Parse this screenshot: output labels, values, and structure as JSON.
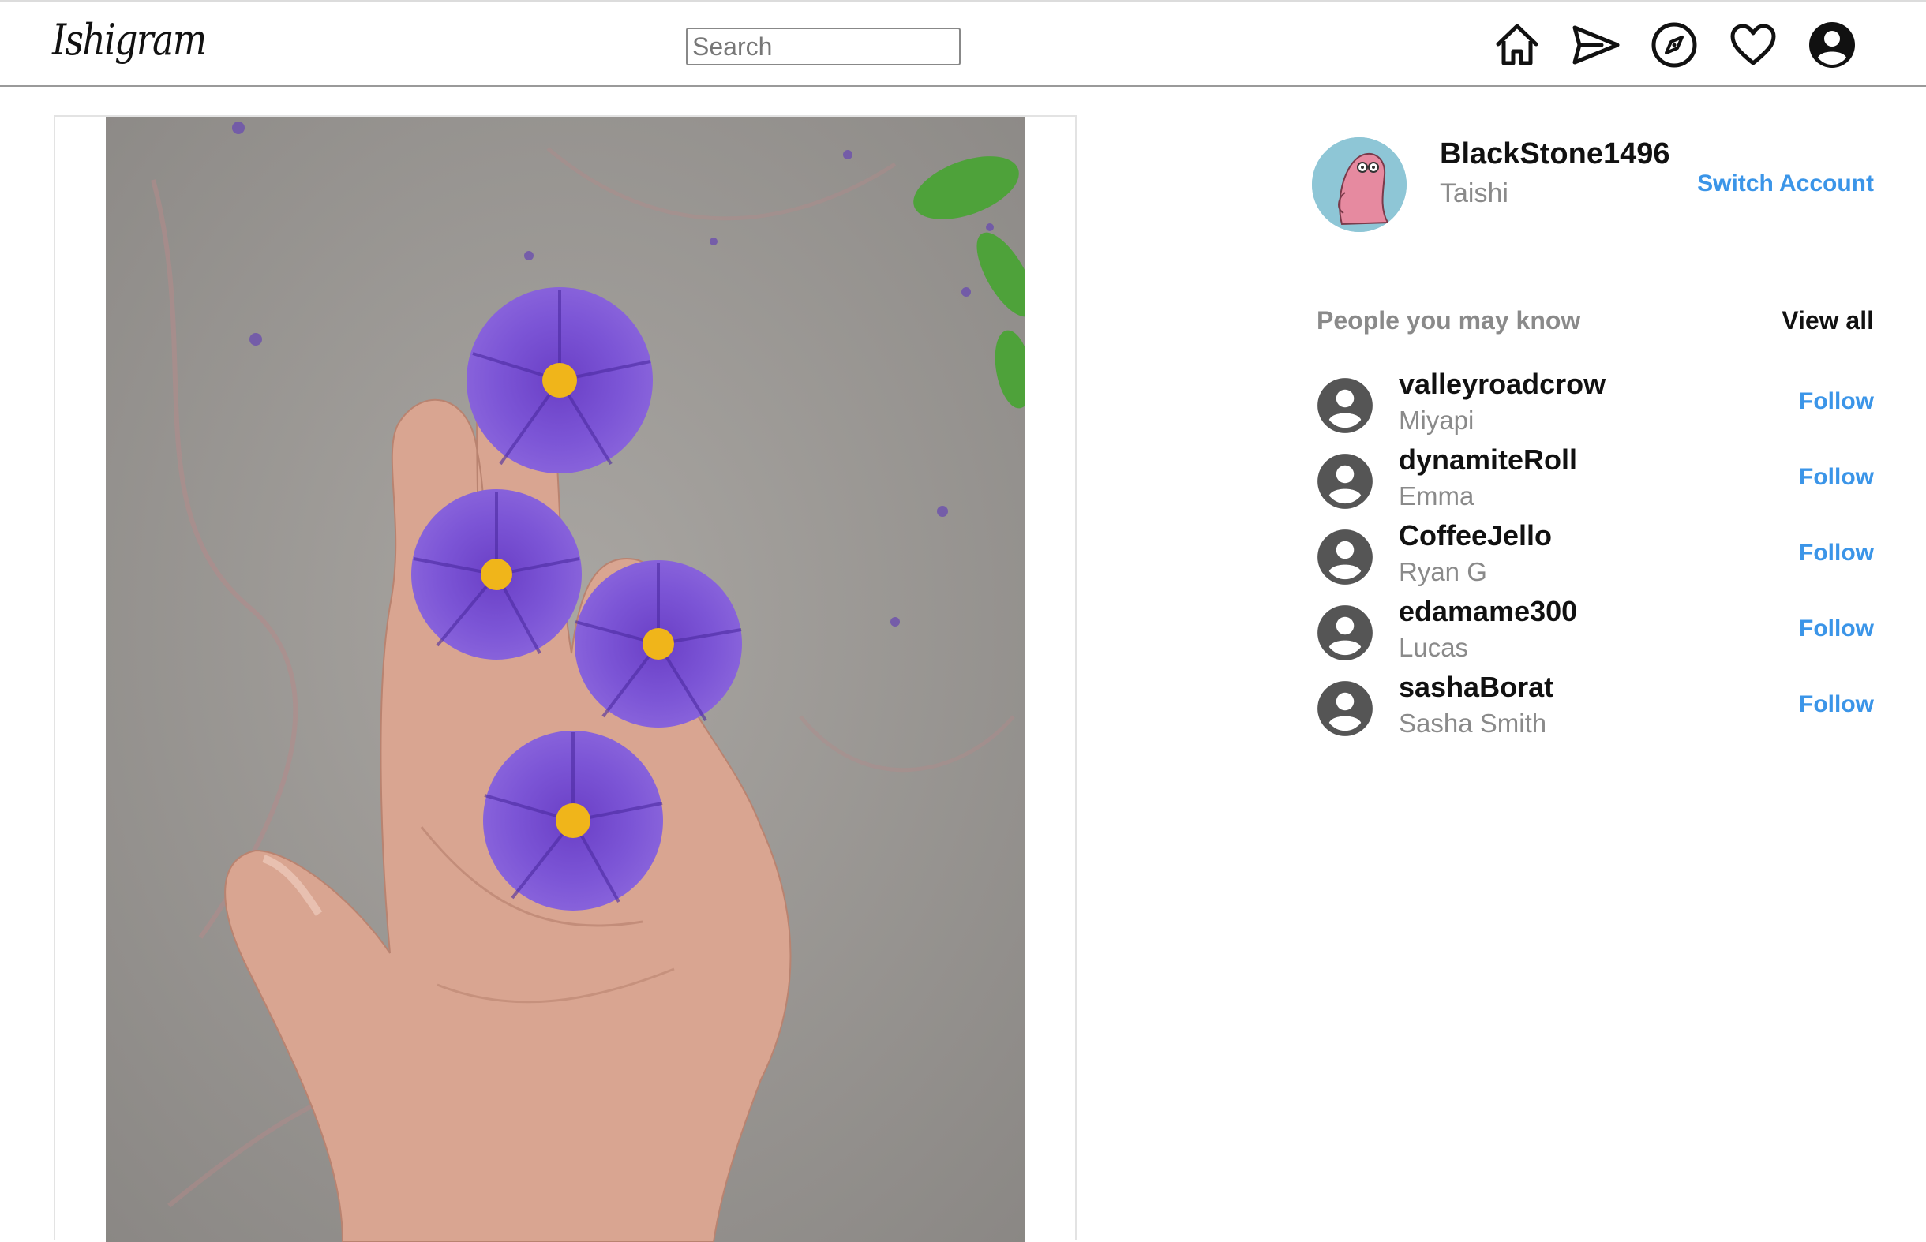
{
  "app": {
    "logo": "Ishigram"
  },
  "header": {
    "search_placeholder": "Search",
    "icons": [
      "home-icon",
      "send-icon",
      "explore-icon",
      "heart-icon",
      "profile-icon"
    ]
  },
  "post": {
    "image_subject": "hand-holding-purple-flowers",
    "colors": {
      "flower": "#7a4fd0",
      "flower_center": "#f0b51a",
      "concrete": "#9c9996"
    }
  },
  "current_user": {
    "username": "BlackStone1496",
    "full_name": "Taishi",
    "switch_label": "Switch Account"
  },
  "suggestions": {
    "heading": "People you may know",
    "view_all_label": "View all",
    "follow_label": "Follow",
    "people": [
      {
        "username": "valleyroadcrow",
        "full_name": "Miyapi"
      },
      {
        "username": "dynamiteRoll",
        "full_name": "Emma"
      },
      {
        "username": "CoffeeJello",
        "full_name": "Ryan G"
      },
      {
        "username": "edamame300",
        "full_name": "Lucas"
      },
      {
        "username": "sashaBorat",
        "full_name": "Sasha Smith"
      }
    ]
  },
  "theme": {
    "link_color": "#3b95e8",
    "muted_text": "#8a8a8a"
  }
}
